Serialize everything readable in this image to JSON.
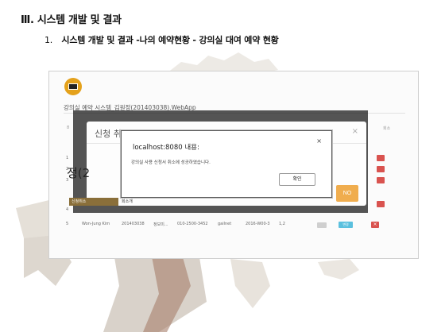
{
  "slide": {
    "title": "Ⅲ. 시스템 개발 및 결과",
    "subtitle_prefix": "1.",
    "subtitle": "시스템 개발 및 결과 -나의 예약현황 - 강의실 대여 예약 현황"
  },
  "app": {
    "title": "강의실 예약 시스템_김원정(201403038).WebApp",
    "header_num": "8",
    "header_right": "회소",
    "row_numbers": [
      "1",
      "2",
      "3",
      "4",
      "5"
    ],
    "row5": {
      "name": "Won-Jung Kim",
      "id": "201403038",
      "dept": "정보미...",
      "phone": "010-2500-3452",
      "email": "gailnet",
      "date": "2016-W00-3",
      "time": "1,2",
      "edit_label": "변경"
    },
    "bg_year_text": "정(2",
    "bg_row4_label": "신청취소",
    "bg_row4_right": "회소개"
  },
  "modal": {
    "title": "신청 취",
    "close": "×",
    "no_button": "NO"
  },
  "alert": {
    "title": "localhost:8080 내용:",
    "close": "×",
    "message": "강의실 사용 신청서 취소에 성공하였습니다.",
    "ok_button": "확인"
  },
  "colors": {
    "logo": "#e4a11b",
    "no_button": "#f0ad4e",
    "delete_button": "#d9534f",
    "edit_button": "#5bc0de"
  }
}
